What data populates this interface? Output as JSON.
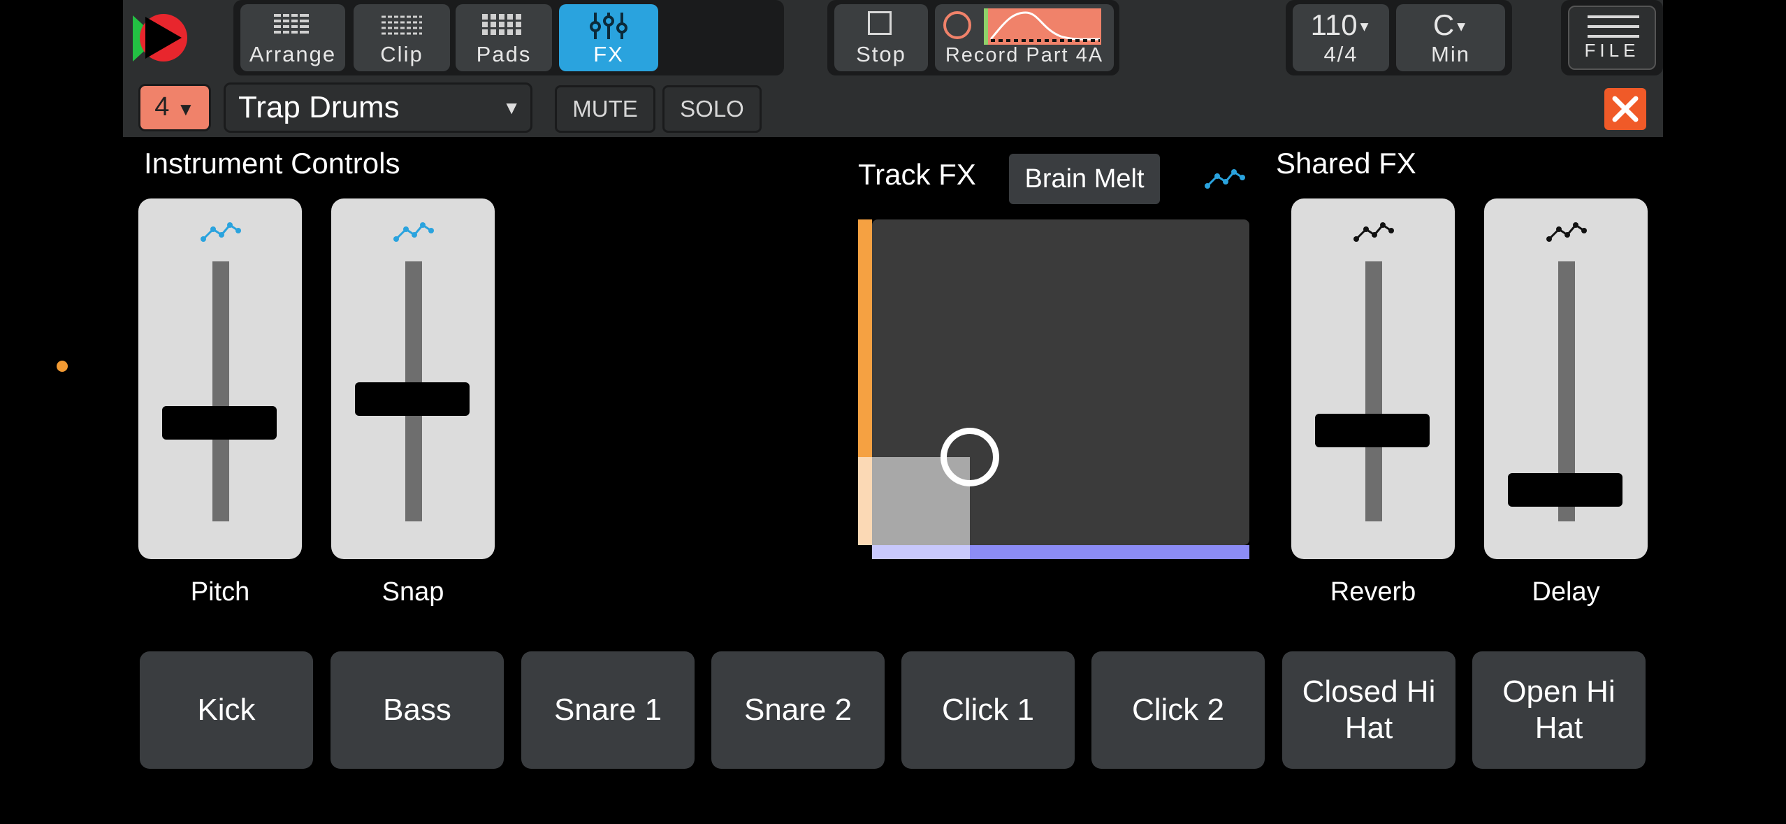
{
  "top_bar": {
    "nav": [
      {
        "label": "Arrange",
        "icon": "arrange-grid-icon",
        "active": false
      },
      {
        "label": "Clip",
        "icon": "clip-icon",
        "active": false
      },
      {
        "label": "Pads",
        "icon": "pads-grid-icon",
        "active": false
      },
      {
        "label": "FX",
        "icon": "fx-sliders-icon",
        "active": true
      }
    ],
    "stop_label": "Stop",
    "record_label": "Record Part 4A",
    "tempo": "110",
    "time_signature": "4/4",
    "key": "C",
    "scale": "Min",
    "file_label": "FILE"
  },
  "track_bar": {
    "track_number": "4",
    "instrument": "Trap Drums",
    "mute_label": "MUTE",
    "solo_label": "SOLO"
  },
  "instrument_controls": {
    "title": "Instrument Controls",
    "sliders": [
      {
        "label": "Pitch",
        "value": 0.38
      },
      {
        "label": "Snap",
        "value": 0.47
      }
    ]
  },
  "track_fx": {
    "title": "Track FX",
    "preset": "Brain Melt",
    "xy_x": 0.26,
    "xy_y": 0.27
  },
  "shared_fx": {
    "title": "Shared FX",
    "sliders": [
      {
        "label": "Reverb",
        "value": 0.35
      },
      {
        "label": "Delay",
        "value": 0.12
      }
    ]
  },
  "pads": [
    "Kick",
    "Bass",
    "Snare 1",
    "Snare 2",
    "Click 1",
    "Click 2",
    "Closed Hi Hat",
    "Open Hi Hat"
  ],
  "colors": {
    "accent_blue": "#2aa3de",
    "record_orange": "#f0826a",
    "close_red": "#f05a28",
    "xy_orange": "#f5a142",
    "xy_purple": "#8c8cf5"
  }
}
